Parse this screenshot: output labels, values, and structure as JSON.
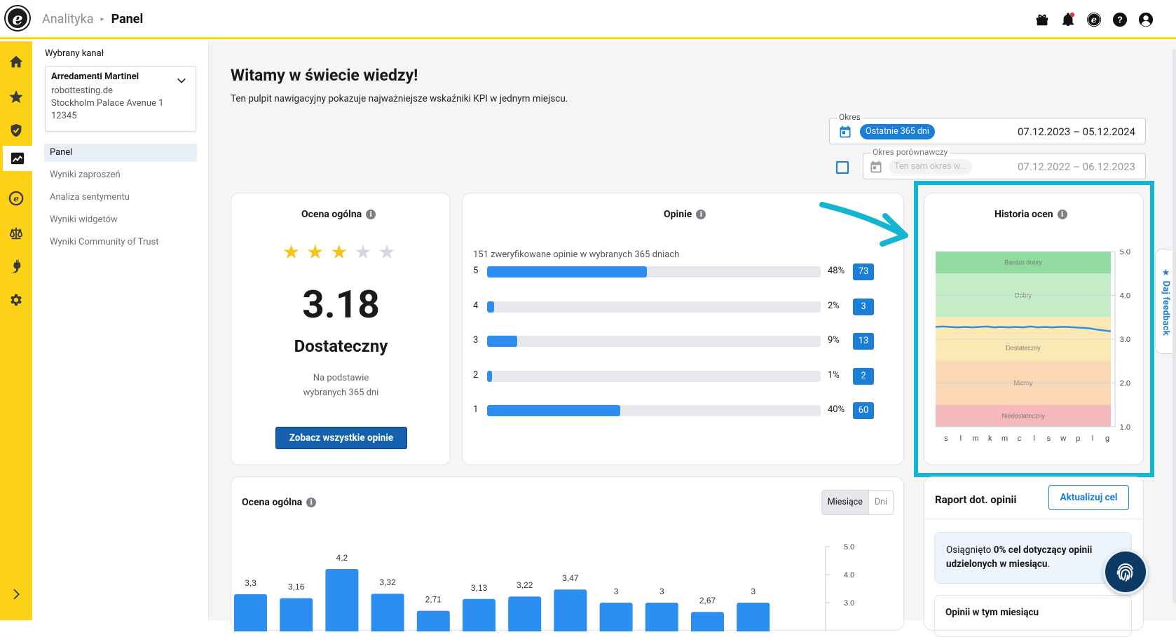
{
  "header": {
    "breadcrumb_parent": "Analityka",
    "breadcrumb_current": "Panel",
    "icons": [
      "gift-icon",
      "bell-icon",
      "trusted-logo-icon",
      "help-icon",
      "account-icon"
    ]
  },
  "rail": {
    "items": [
      "home-icon",
      "star-icon",
      "shield-check-icon",
      "analytics-icon",
      "trusted-badge-icon",
      "scales-icon",
      "plug-icon",
      "settings-icon"
    ],
    "active": "analytics-icon",
    "expand_icon": "chevron-right-icon"
  },
  "sidebar": {
    "channel_label": "Wybrany kanał",
    "channel": {
      "name": "Arredamenti Martinel",
      "line1": "robottesting.de",
      "line2": "Stockholm Palace Avenue 1",
      "line3": "12345"
    },
    "items": [
      {
        "label": "Panel",
        "active": true
      },
      {
        "label": "Wyniki zaproszeń",
        "active": false
      },
      {
        "label": "Analiza sentymentu",
        "active": false
      },
      {
        "label": "Wyniki widgetów",
        "active": false
      },
      {
        "label": "Wyniki Community of Trust",
        "active": false
      }
    ]
  },
  "page": {
    "title": "Witamy w świecie wiedzy!",
    "subtitle": "Ten pulpit nawigacyjny pokazuje najważniejsze wskaźniki KPI w jednym miejscu."
  },
  "period": {
    "label": "Okres",
    "chip": "Ostatnie 365 dni",
    "range": "07.12.2023 – 05.12.2024"
  },
  "compare_period": {
    "label": "Okres porównawczy",
    "chip": "Ten sam okres w...",
    "range": "07.12.2022 – 06.12.2023",
    "checked": false
  },
  "overall": {
    "title": "Ocena ogólna",
    "stars_filled": 3,
    "stars_total": 5,
    "score": "3.18",
    "grade": "Dostateczny",
    "basis_line1": "Na podstawie",
    "basis_line2": "wybranych 365 dni",
    "button": "Zobacz wszystkie opinie"
  },
  "reviews": {
    "title": "Opinie",
    "summary": "151 zweryfikowane opinie w wybranych 365 dniach",
    "rows": [
      {
        "star": "5",
        "percent": 48,
        "percent_label": "48%",
        "count": "73"
      },
      {
        "star": "4",
        "percent": 2,
        "percent_label": "2%",
        "count": "3"
      },
      {
        "star": "3",
        "percent": 9,
        "percent_label": "9%",
        "count": "13"
      },
      {
        "star": "2",
        "percent": 1,
        "percent_label": "1%",
        "count": "2"
      },
      {
        "star": "1",
        "percent": 40,
        "percent_label": "40%",
        "count": "60"
      }
    ]
  },
  "history": {
    "title": "Historia ocen",
    "bands": [
      "Bardzo dobry",
      "Dobry",
      "Dostateczny",
      "Mierny",
      "Niedostateczny"
    ],
    "band_colors": [
      "#92dba0",
      "#c3ecc7",
      "#fbe9b3",
      "#fbd7b6",
      "#f5b9bd"
    ],
    "line_color": "#2c8ef0",
    "y_ticks": [
      "5.0",
      "4.0",
      "3.0",
      "2.0",
      "1.0"
    ],
    "x_ticks": [
      "s",
      "l",
      "m",
      "k",
      "m",
      "c",
      "l",
      "s",
      "w",
      "p",
      "l",
      "g"
    ],
    "line_values": [
      3.28,
      3.29,
      3.28,
      3.27,
      3.28,
      3.27,
      3.28,
      3.29,
      3.27,
      3.28,
      3.27,
      3.28,
      3.27,
      3.29,
      3.27,
      3.28,
      3.27,
      3.28,
      3.28,
      3.27,
      3.26,
      3.25,
      3.22,
      3.2,
      3.18
    ]
  },
  "monthly": {
    "title": "Ocena ogólna",
    "toggle_months": "Miesiące",
    "toggle_days": "Dni",
    "y_ticks": [
      "5.0",
      "4.0",
      "3.0"
    ],
    "bar_labels": [
      "3,3",
      "3,16",
      "4,2",
      "3,32",
      "2,71",
      "3,13",
      "3,22",
      "3,47",
      "3",
      "3",
      "2,67",
      "3"
    ],
    "bar_color": "#2c8ef0"
  },
  "report": {
    "title": "Raport dot. opinii",
    "button": "Aktualizuj cel",
    "goal_prefix": "Osiągnięto ",
    "goal_bold": "0% cel dotyczący opinii udzielonych w miesiącu",
    "goal_suffix": ".",
    "month_title": "Opinii w tym miesiącu"
  },
  "feedback_tab": "Daj feedback",
  "chart_data": [
    {
      "type": "bar",
      "title": "Ocena ogólna",
      "x": [
        "s",
        "l",
        "m",
        "k",
        "m",
        "c",
        "l",
        "s",
        "w",
        "p",
        "l",
        "g"
      ],
      "categories": [
        "s",
        "l",
        "m",
        "k",
        "m",
        "c",
        "l",
        "s",
        "w",
        "p",
        "l",
        "g"
      ],
      "values": [
        3.3,
        3.16,
        4.2,
        3.32,
        2.71,
        3.13,
        3.22,
        3.47,
        3,
        3,
        2.67,
        3
      ],
      "ylim": [
        1,
        5
      ],
      "grid": false
    },
    {
      "type": "line",
      "title": "Historia ocen",
      "categories": [
        "s",
        "l",
        "m",
        "k",
        "m",
        "c",
        "l",
        "s",
        "w",
        "p",
        "l",
        "g"
      ],
      "ylim": [
        1,
        5
      ],
      "series": [
        {
          "values": [
            3.28,
            3.29,
            3.28,
            3.27,
            3.28,
            3.27,
            3.28,
            3.29,
            3.27,
            3.28,
            3.27,
            3.28,
            3.27,
            3.29,
            3.27,
            3.28,
            3.27,
            3.28,
            3.28,
            3.27,
            3.26,
            3.25,
            3.22,
            3.2,
            3.18
          ]
        }
      ]
    }
  ]
}
